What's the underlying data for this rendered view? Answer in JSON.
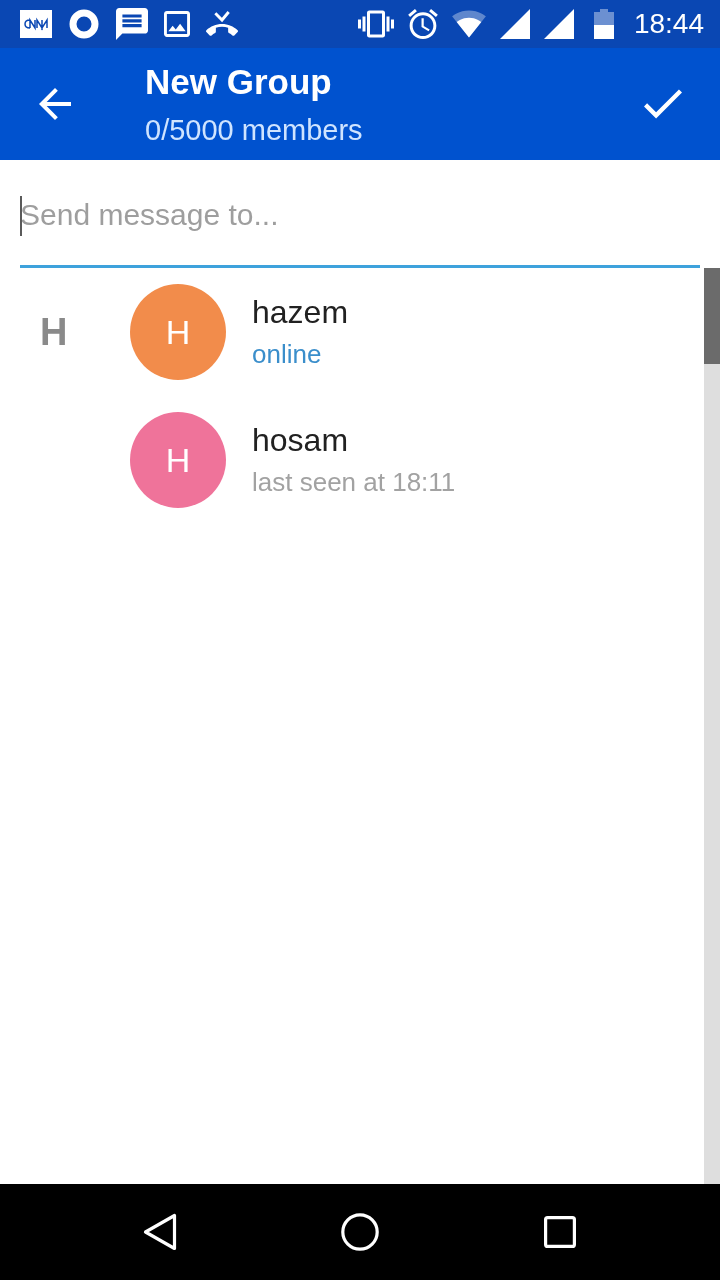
{
  "status_bar": {
    "time": "18:44"
  },
  "app_bar": {
    "title": "New Group",
    "subtitle": "0/5000 members"
  },
  "search": {
    "placeholder": "Send message to..."
  },
  "sections": [
    {
      "letter": "H",
      "contacts": [
        {
          "name": "hazem",
          "initial": "H",
          "status": "online",
          "online": true,
          "color": "#f28c4b"
        },
        {
          "name": "hosam",
          "initial": "H",
          "status": "last seen at 18:11",
          "online": false,
          "color": "#ef739a"
        }
      ]
    }
  ]
}
